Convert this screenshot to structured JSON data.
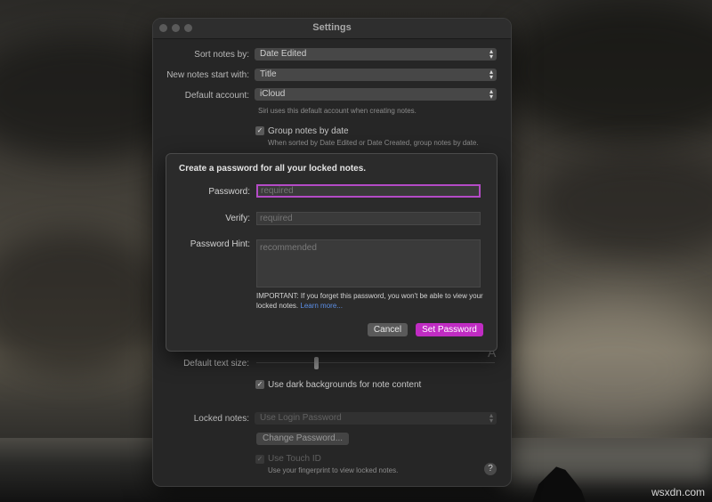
{
  "window": {
    "title": "Settings"
  },
  "settings": {
    "sort_label": "Sort notes by:",
    "sort_value": "Date Edited",
    "new_label": "New notes start with:",
    "new_value": "Title",
    "account_label": "Default account:",
    "account_value": "iCloud",
    "siri_note": "Siri uses this default account when creating notes.",
    "group_label": "Group notes by date",
    "group_checked": true,
    "group_desc": "When sorted by Date Edited or Date Created, group notes by date.",
    "text_size_label": "Default text size:",
    "text_size_big": "A",
    "dark_label": "Use dark backgrounds for note content",
    "dark_checked": true,
    "locked_label": "Locked notes:",
    "locked_value": "Use Login Password",
    "change_password": "Change Password...",
    "touchid_label": "Use Touch ID",
    "touchid_desc": "Use your fingerprint to view locked notes.",
    "help": "?"
  },
  "dialog": {
    "title": "Create a password for all your locked notes.",
    "password_label": "Password:",
    "password_placeholder": "required",
    "verify_label": "Verify:",
    "verify_placeholder": "required",
    "hint_label": "Password Hint:",
    "hint_placeholder": "recommended",
    "important_text": "IMPORTANT: If you forget this password, you won't be able to view your locked notes.",
    "learn_more": "Learn more...",
    "cancel_label": "Cancel",
    "set_label": "Set Password"
  },
  "colors": {
    "accent": "#c02cc3",
    "focus_ring": "#b44bc6",
    "link": "#5b8ee6"
  },
  "watermark": "wsxdn.com"
}
